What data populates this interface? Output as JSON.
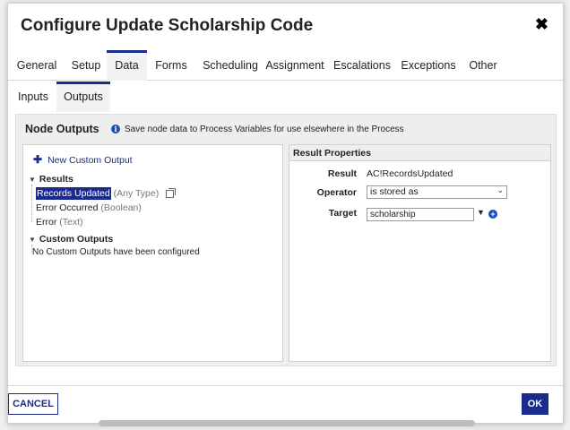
{
  "dialog": {
    "title": "Configure Update Scholarship Code",
    "close_symbol": "✖"
  },
  "tabs": [
    {
      "label": "General"
    },
    {
      "label": "Setup"
    },
    {
      "label": "Data",
      "active": true
    },
    {
      "label": "Forms"
    },
    {
      "label": "Scheduling"
    },
    {
      "label": "Assignment"
    },
    {
      "label": "Escalations"
    },
    {
      "label": "Exceptions"
    },
    {
      "label": "Other"
    }
  ],
  "subtabs": [
    {
      "label": "Inputs"
    },
    {
      "label": "Outputs",
      "active": true
    }
  ],
  "node_outputs": {
    "title": "Node Outputs",
    "info_text": "Save node data to Process Variables for use elsewhere in the Process"
  },
  "left_panel": {
    "new_output_label": "New Custom Output",
    "results_header": "Results",
    "results": [
      {
        "name": "Records Updated",
        "type": "(Any Type)",
        "selected": true
      },
      {
        "name": "Error Occurred",
        "type": "(Boolean)"
      },
      {
        "name": "Error",
        "type": "(Text)"
      }
    ],
    "custom_header": "Custom Outputs",
    "custom_empty": "No Custom Outputs have been configured"
  },
  "right_panel": {
    "header": "Result Properties",
    "result_label": "Result",
    "result_value": "AC!RecordsUpdated",
    "operator_label": "Operator",
    "operator_value": "is stored as",
    "target_label": "Target",
    "target_value": "scholarship"
  },
  "footer": {
    "cancel_label": "CANCEL",
    "ok_label": "OK"
  },
  "colors": {
    "accent": "#1b2a8f",
    "info": "#1b4fb8"
  }
}
